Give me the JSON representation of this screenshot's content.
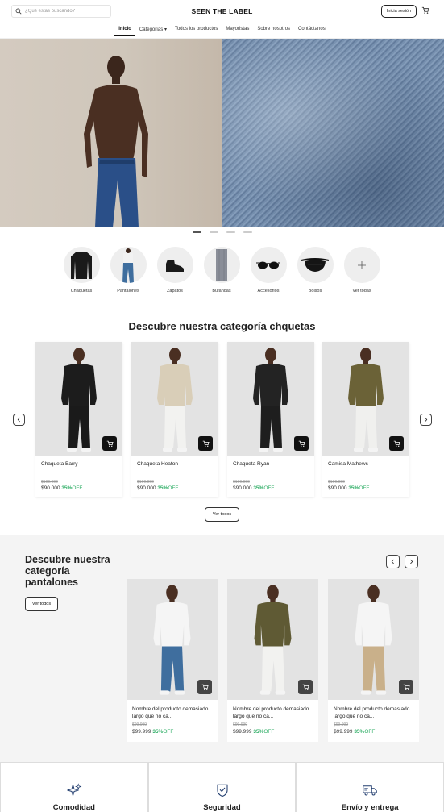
{
  "header": {
    "search_placeholder": "¿Qué estas buscando?",
    "brand": "SEEN THE LABEL",
    "login_label": "Inicia sesión"
  },
  "nav": {
    "items": [
      {
        "label": "Inicio"
      },
      {
        "label": "Categorías ▾"
      },
      {
        "label": "Todos los productos"
      },
      {
        "label": "Mayoristas"
      },
      {
        "label": "Sobre nosotros"
      },
      {
        "label": "Contáctanos"
      }
    ]
  },
  "hero": {
    "slide_count": 4,
    "active_slide": 1
  },
  "categories": [
    {
      "label": "Chaquetas",
      "icon": "jacket-icon"
    },
    {
      "label": "Pantalones",
      "icon": "pants-icon"
    },
    {
      "label": "Zapatos",
      "icon": "shoe-icon"
    },
    {
      "label": "Bufandas",
      "icon": "scarf-icon"
    },
    {
      "label": "Accesorios",
      "icon": "sunglasses-icon"
    },
    {
      "label": "Bolsos",
      "icon": "bag-icon"
    },
    {
      "label": "Ver todas",
      "icon": "plus-icon"
    }
  ],
  "section_jackets": {
    "title": "Descubre nuestra categoría chquetas",
    "view_all": "Ver todos",
    "products": [
      {
        "name": "Chaqueta Barry",
        "old_price": "$100.000",
        "price": "$90.000",
        "discount": "35%",
        "off": "OFF",
        "colors": {
          "top": "#1c1c1c",
          "bottom": "#1a1a1a"
        }
      },
      {
        "name": "Chaqueta Heaton",
        "old_price": "$100.000",
        "price": "$90.000",
        "discount": "35%",
        "off": "OFF",
        "colors": {
          "top": "#d9ceb8",
          "bottom": "#f2f2f0"
        }
      },
      {
        "name": "Chaqueta Ryan",
        "old_price": "$100.000",
        "price": "$90.000",
        "discount": "35%",
        "off": "OFF",
        "colors": {
          "top": "#232323",
          "bottom": "#1e1e1e"
        }
      },
      {
        "name": "Camisa Mathews",
        "old_price": "$100.000",
        "price": "$90.000",
        "discount": "35%",
        "off": "OFF",
        "colors": {
          "top": "#6b6237",
          "bottom": "#f0f0ee"
        }
      }
    ]
  },
  "section_pants": {
    "title": "Descubre nuestra categoría pantalones",
    "view_all": "Ver todos",
    "products": [
      {
        "name": "Nombre del producto demasiado largo que no ca...",
        "old_price": "$99.999",
        "price": "$99.999",
        "discount": "35%",
        "off": "OFF",
        "colors": {
          "top": "#f5f5f5",
          "bottom": "#3f6e9e"
        }
      },
      {
        "name": "Nombre del producto demasiado largo que no ca...",
        "old_price": "$99.999",
        "price": "$99.999",
        "discount": "35%",
        "off": "OFF",
        "colors": {
          "top": "#5f5a34",
          "bottom": "#f2f2f0"
        }
      },
      {
        "name": "Nombre del producto demasiado largo que no ca...",
        "old_price": "$99.999",
        "price": "$99.999",
        "discount": "35%",
        "off": "OFF",
        "colors": {
          "top": "#f5f5f5",
          "bottom": "#c9b08a"
        }
      }
    ]
  },
  "features": [
    {
      "label": "Comodidad",
      "icon": "sparkle-icon"
    },
    {
      "label": "Seguridad",
      "icon": "shield-check-icon"
    },
    {
      "label": "Envío y entrega",
      "icon": "truck-icon"
    }
  ],
  "colors": {
    "accent_discount": "#2fae66",
    "dark": "#111111"
  }
}
